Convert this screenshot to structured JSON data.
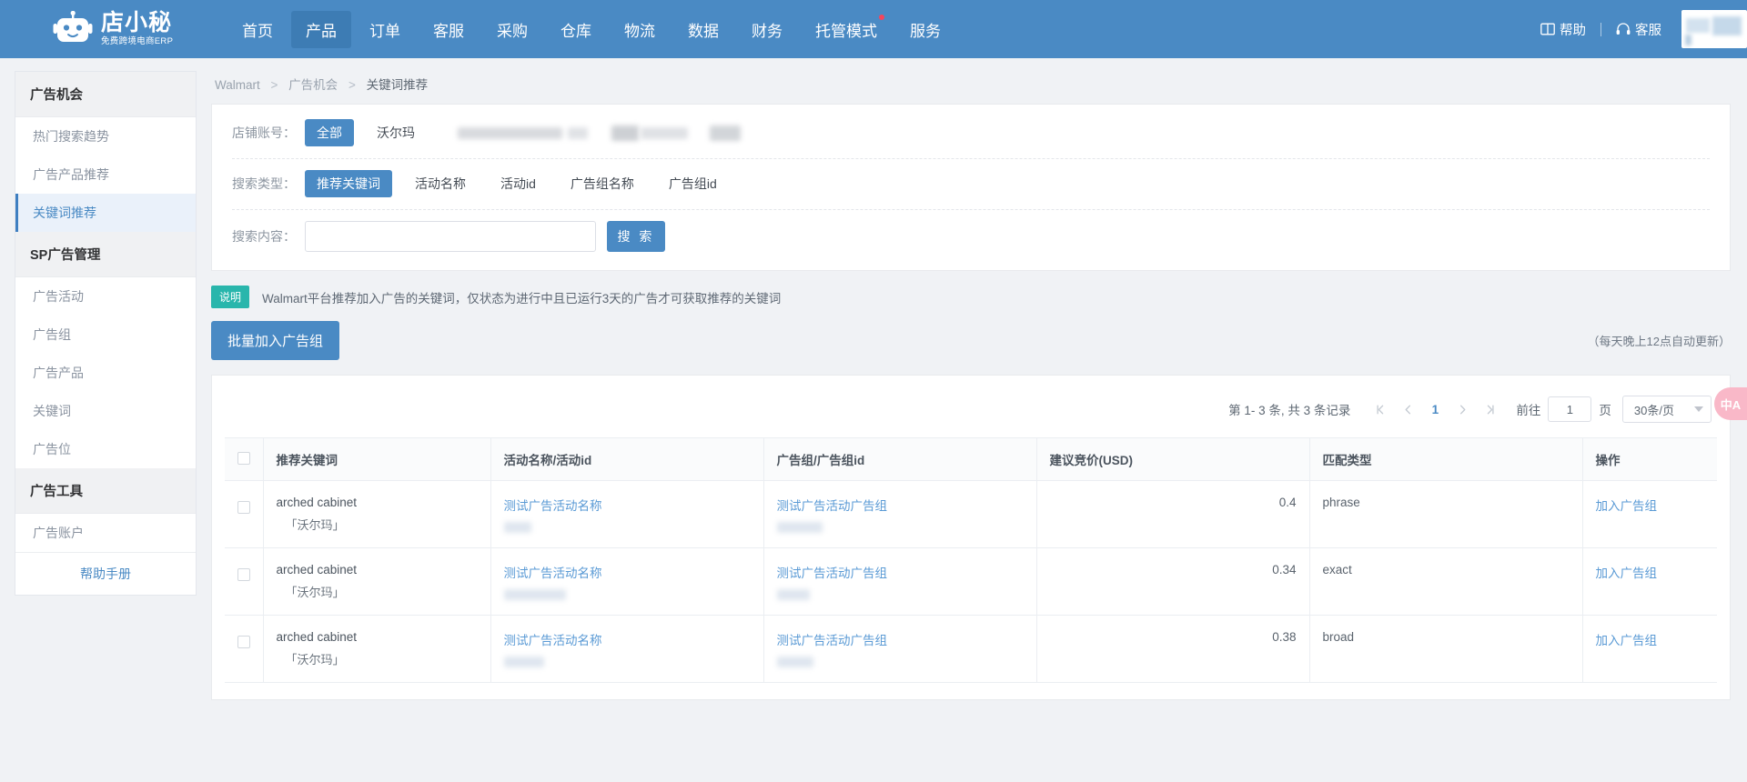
{
  "brand": {
    "name": "店小秘",
    "tagline": "免费跨境电商ERP",
    "logo_icon": "robot-icon"
  },
  "topnav": {
    "items": [
      {
        "label": "首页",
        "active": false,
        "dot": false
      },
      {
        "label": "产品",
        "active": true,
        "dot": false
      },
      {
        "label": "订单",
        "active": false,
        "dot": false
      },
      {
        "label": "客服",
        "active": false,
        "dot": false
      },
      {
        "label": "采购",
        "active": false,
        "dot": false
      },
      {
        "label": "仓库",
        "active": false,
        "dot": false
      },
      {
        "label": "物流",
        "active": false,
        "dot": false
      },
      {
        "label": "数据",
        "active": false,
        "dot": false
      },
      {
        "label": "财务",
        "active": false,
        "dot": false
      },
      {
        "label": "托管模式",
        "active": false,
        "dot": true
      },
      {
        "label": "服务",
        "active": false,
        "dot": false
      }
    ],
    "help_label": "帮助",
    "help_icon": "book-icon",
    "support_label": "客服",
    "support_icon": "headset-icon"
  },
  "sidebar": {
    "groups": [
      {
        "title": "广告机会",
        "items": [
          {
            "label": "热门搜索趋势",
            "active": false
          },
          {
            "label": "广告产品推荐",
            "active": false
          },
          {
            "label": "关键词推荐",
            "active": true
          }
        ]
      },
      {
        "title": "SP广告管理",
        "items": [
          {
            "label": "广告活动",
            "active": false
          },
          {
            "label": "广告组",
            "active": false
          },
          {
            "label": "广告产品",
            "active": false
          },
          {
            "label": "关键词",
            "active": false
          },
          {
            "label": "广告位",
            "active": false
          }
        ]
      },
      {
        "title": "广告工具",
        "items": [
          {
            "label": "广告账户",
            "active": false
          }
        ]
      }
    ],
    "footer_label": "帮助手册"
  },
  "breadcrumb": {
    "root": "Walmart",
    "middle": "广告机会",
    "current": "关键词推荐",
    "separator": ">"
  },
  "filters": {
    "shop_label": "店铺账号：",
    "shop_options": [
      {
        "label": "全部",
        "active": true
      },
      {
        "label": "沃尔玛",
        "active": false
      }
    ],
    "search_type_label": "搜索类型：",
    "search_types": [
      {
        "label": "推荐关键词",
        "active": true
      },
      {
        "label": "活动名称",
        "active": false
      },
      {
        "label": "活动id",
        "active": false
      },
      {
        "label": "广告组名称",
        "active": false
      },
      {
        "label": "广告组id",
        "active": false
      }
    ],
    "search_content_label": "搜索内容：",
    "search_value": "",
    "search_placeholder": "",
    "search_button": "搜 索"
  },
  "notice": {
    "tag": "说明",
    "text": "Walmart平台推荐加入广告的关键词，仅状态为进行中且已运行3天的广告才可获取推荐的关键词"
  },
  "actions": {
    "bulk_button": "批量加入广告组",
    "auto_update_note": "（每天晚上12点自动更新）"
  },
  "pagination": {
    "total_text": "第 1- 3 条, 共 3 条记录",
    "first_icon": "first-page-icon",
    "prev_icon": "prev-page-icon",
    "current_page": "1",
    "next_icon": "next-page-icon",
    "last_icon": "last-page-icon",
    "goto_label": "前往",
    "goto_value": "1",
    "page_unit": "页",
    "page_size": "30条/页"
  },
  "table": {
    "columns": [
      "推荐关键词",
      "活动名称/活动id",
      "广告组/广告组id",
      "建议竞价(USD)",
      "匹配类型",
      "操作"
    ],
    "rows": [
      {
        "keyword": "arched cabinet",
        "keyword_sub": "「沃尔玛」",
        "campaign": "测试广告活动名称",
        "campaign_id_blurred": true,
        "adgroup": "测试广告活动广告组",
        "adgroup_id_blurred": true,
        "bid": "0.4",
        "match_type": "phrase",
        "action": "加入广告组"
      },
      {
        "keyword": "arched cabinet",
        "keyword_sub": "「沃尔玛」",
        "campaign": "测试广告活动名称",
        "campaign_id_blurred": true,
        "adgroup": "测试广告活动广告组",
        "adgroup_id_blurred": true,
        "bid": "0.34",
        "match_type": "exact",
        "action": "加入广告组"
      },
      {
        "keyword": "arched cabinet",
        "keyword_sub": "「沃尔玛」",
        "campaign": "测试广告活动名称",
        "campaign_id_blurred": true,
        "adgroup": "测试广告活动广告组",
        "adgroup_id_blurred": true,
        "bid": "0.38",
        "match_type": "broad",
        "action": "加入广告组"
      }
    ]
  },
  "floating": {
    "translate_label": "中A"
  },
  "colors": {
    "brand_blue": "#4a8ac4",
    "nav_active": "#3d7cb4",
    "link_blue": "#5a9ad5",
    "notice_green": "#29b6ac",
    "alert_red": "#f5455c",
    "translate_pink": "#f9b8c8"
  }
}
